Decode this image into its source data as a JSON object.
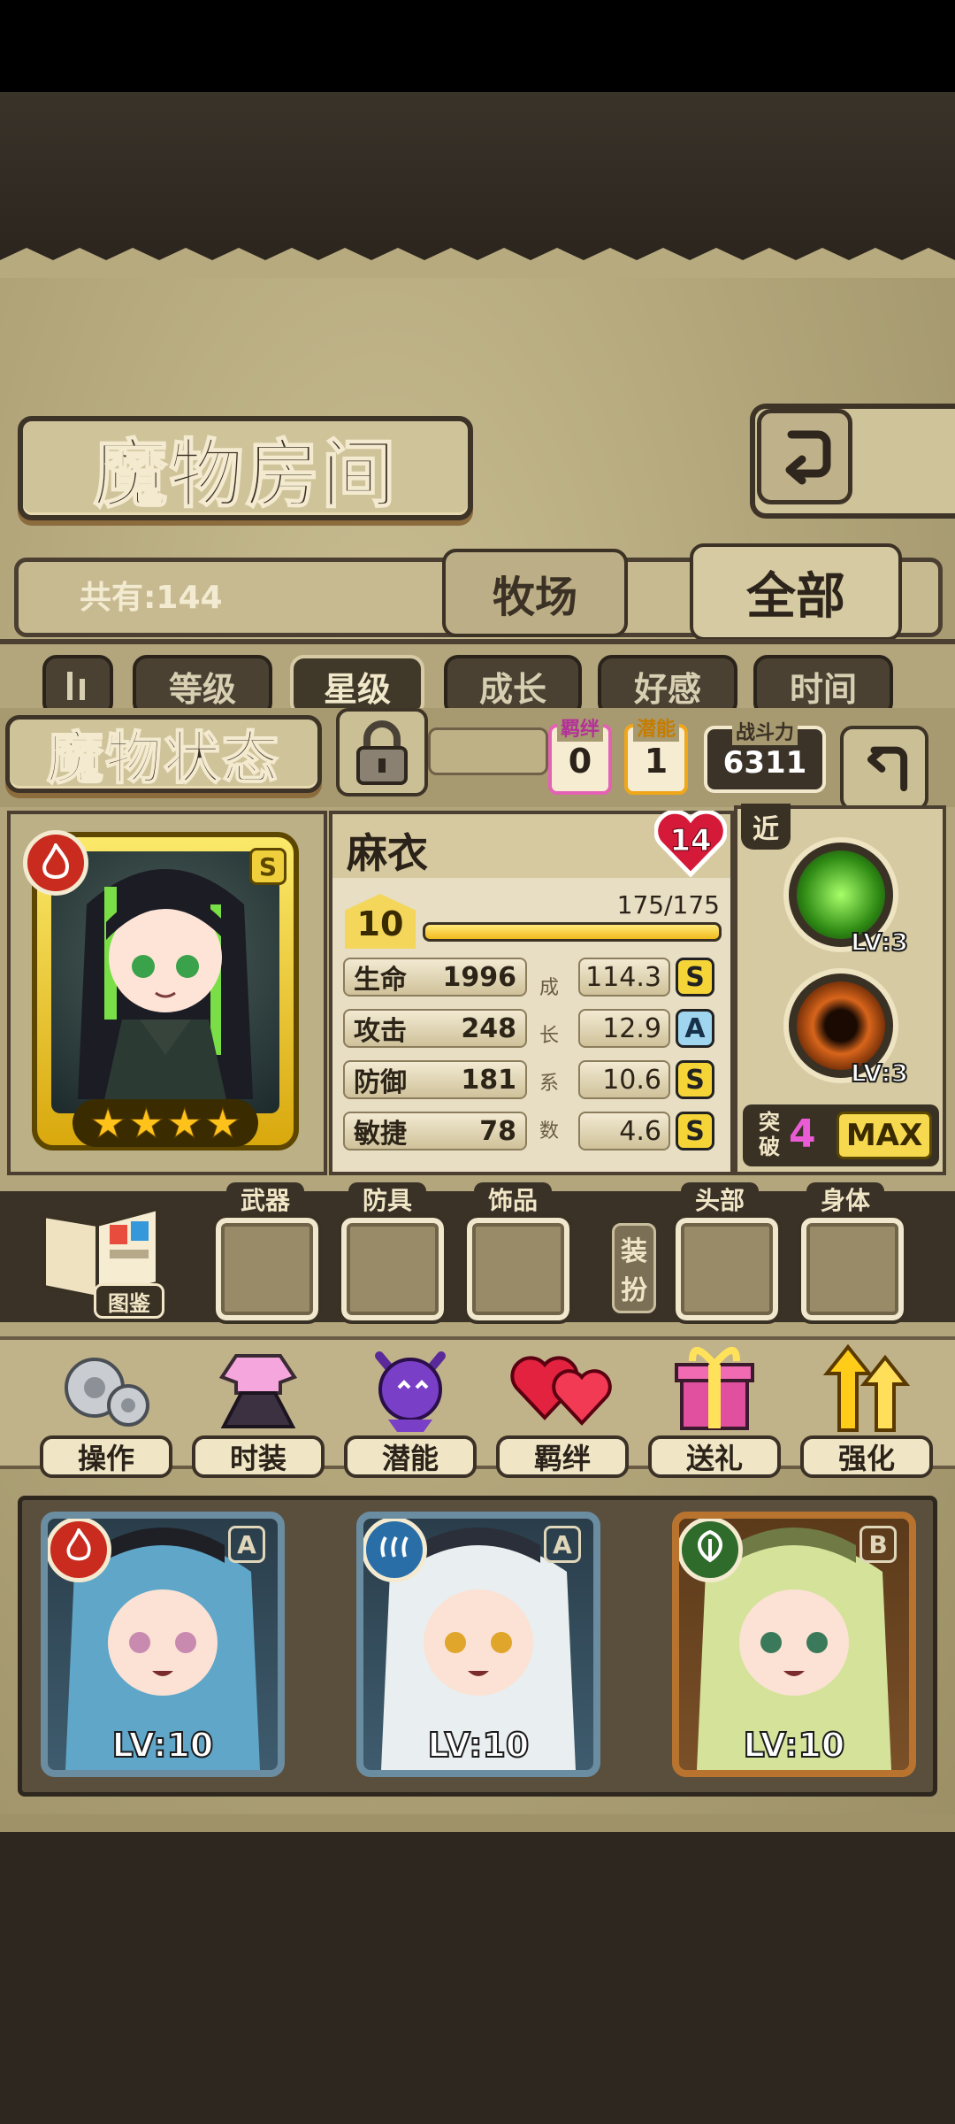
{
  "header": {
    "title": "魔物房间"
  },
  "collection": {
    "count_text": "共有:144",
    "tabs": [
      "牧场",
      "全部"
    ]
  },
  "sort_tabs": [
    "等级",
    "星级",
    "成长",
    "好感",
    "时间"
  ],
  "status": {
    "title": "魔物状态",
    "bond_label": "羁绊",
    "bond_value": "0",
    "potential_label": "潜能",
    "potential_value": "1",
    "power_label": "战斗力",
    "power_value": "6311"
  },
  "monster": {
    "name": "麻衣",
    "hearts": "14",
    "rarity": "S",
    "level": "10",
    "exp_text": "175/175",
    "exp_fraction": 1.0,
    "stars": 4,
    "element_icon": "fire-icon",
    "element_color": "#c92b1f",
    "stats": [
      {
        "label": "生命",
        "value": "1996",
        "growth": "114.3",
        "grade": "S"
      },
      {
        "label": "攻击",
        "value": "248",
        "growth": "12.9",
        "grade": "A"
      },
      {
        "label": "防御",
        "value": "181",
        "growth": "10.6",
        "grade": "S"
      },
      {
        "label": "敏捷",
        "value": "78",
        "growth": "4.6",
        "grade": "S"
      }
    ],
    "growth_vertical": [
      "成",
      "长",
      "系",
      "数"
    ]
  },
  "skills": {
    "range_label": "近",
    "items": [
      {
        "name": "green-skill-icon",
        "level": "LV:3",
        "color": "#4fc12a"
      },
      {
        "name": "orange-skill-icon",
        "level": "LV:3",
        "color": "#d8651b"
      }
    ],
    "breakthrough_label_top": "突",
    "breakthrough_label_bottom": "破",
    "breakthrough_value": "4",
    "max_label": "MAX"
  },
  "equipment": {
    "book_label": "图鉴",
    "slots": [
      "武器",
      "防具",
      "饰品"
    ],
    "dress_label_top": "装",
    "dress_label_bottom": "扮",
    "dress_slots": [
      "头部",
      "身体"
    ]
  },
  "menu": [
    {
      "label": "操作",
      "icon": "gear-icon"
    },
    {
      "label": "时装",
      "icon": "dress-icon"
    },
    {
      "label": "潜能",
      "icon": "demon-icon"
    },
    {
      "label": "羁绊",
      "icon": "hearts-icon"
    },
    {
      "label": "送礼",
      "icon": "gift-icon"
    },
    {
      "label": "强化",
      "icon": "arrows-up-icon"
    }
  ],
  "cards": [
    {
      "level": "LV:10",
      "rarity": "A",
      "element_icon": "fire-icon",
      "element_color": "#c92b1f"
    },
    {
      "level": "LV:10",
      "rarity": "A",
      "element_icon": "water-icon",
      "element_color": "#2a6ea8"
    },
    {
      "level": "LV:10",
      "rarity": "B",
      "element_icon": "leaf-icon",
      "element_color": "#2f6b2a"
    }
  ]
}
